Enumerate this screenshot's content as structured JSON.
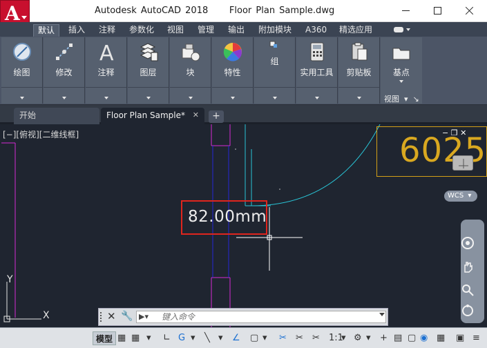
{
  "title_bar": {
    "app_name": "Autodesk AutoCAD 2018",
    "file_name": "Floor Plan Sample.dwg",
    "app_letter": "A"
  },
  "ribbon_tabs": [
    "默认",
    "插入",
    "注释",
    "参数化",
    "视图",
    "管理",
    "输出",
    "附加模块",
    "A360",
    "精选应用"
  ],
  "ribbon_groups": [
    {
      "label": "绘图",
      "icon": "draw-icon"
    },
    {
      "label": "修改",
      "icon": "modify-icon"
    },
    {
      "label": "注释",
      "icon": "annotate-icon"
    },
    {
      "label": "图层",
      "icon": "layers-icon"
    },
    {
      "label": "块",
      "icon": "block-icon"
    },
    {
      "label": "特性",
      "icon": "properties-icon"
    },
    {
      "label": "组",
      "icon": "group-icon"
    },
    {
      "label": "实用工具",
      "icon": "utilities-icon"
    },
    {
      "label": "剪贴板",
      "icon": "clipboard-icon"
    },
    {
      "label": "基点",
      "icon": "basepoint-icon"
    }
  ],
  "ribbon_view_label": "视图",
  "doc_tabs": {
    "start": "开始",
    "document": "Floor Plan Sample*",
    "close": "✕",
    "add": "+"
  },
  "viewport": {
    "label": "[−][俯视][二维线框]",
    "dimension_text": "82.00mm",
    "viewcube_number": "6025",
    "wcs_label": "WCS"
  },
  "command_line": {
    "placeholder": "键入命令",
    "prompt": "▶▾"
  },
  "status_bar": {
    "model_label": "模型",
    "scale": "1:1"
  },
  "colors": {
    "canvas_bg": "#1f2530",
    "magenta": "#d52ad5",
    "cyan": "#29c4d6",
    "blue_line": "#2626d8",
    "dim_box_red": "#e0251d",
    "viewcube_gold": "#d9a820"
  }
}
